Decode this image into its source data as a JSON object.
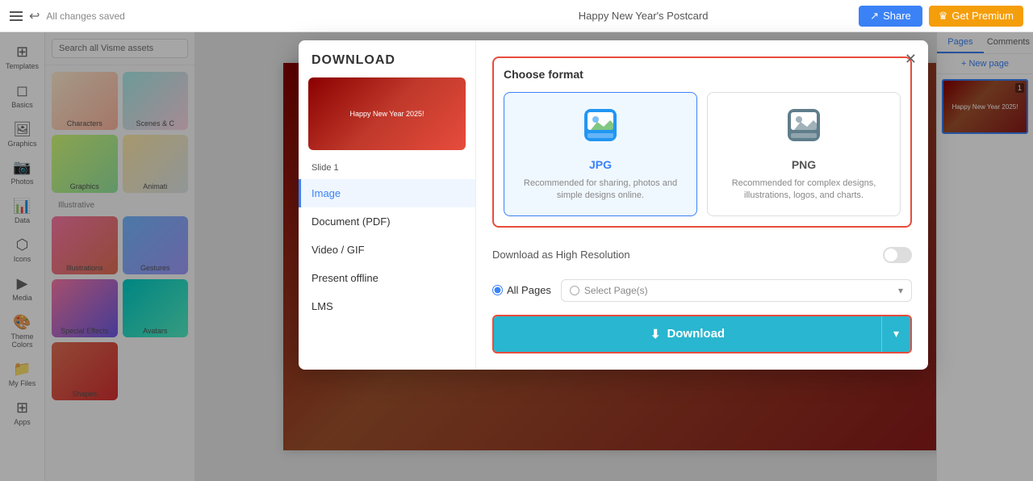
{
  "topbar": {
    "menu_icon": "☰",
    "undo_icon": "↩",
    "saved_text": "All changes saved",
    "title": "Happy New Year&#039;s Postcard",
    "share_label": "Share",
    "share_icon": "↗",
    "premium_label": "Get Premium",
    "premium_icon": "♛"
  },
  "sidebar": {
    "items": [
      {
        "icon": "⊞",
        "label": "Templates"
      },
      {
        "icon": "◻",
        "label": "Basics"
      },
      {
        "icon": "🖼",
        "label": "Graphics"
      },
      {
        "icon": "🖼",
        "label": "Photos"
      },
      {
        "icon": "📊",
        "label": "Data"
      },
      {
        "icon": "⊙",
        "label": "Icons"
      },
      {
        "icon": "▶",
        "label": "Media"
      },
      {
        "icon": "🎨",
        "label": "Theme Colors"
      },
      {
        "icon": "📁",
        "label": "My Files"
      },
      {
        "icon": "⊞",
        "label": "Apps"
      }
    ]
  },
  "asset_panel": {
    "search_placeholder": "Search all Visme assets",
    "section_label": "Illustrative",
    "tiles": [
      {
        "label": "Characters",
        "class": "tile-characters"
      },
      {
        "label": "Scenes & C",
        "class": "tile-scenes"
      },
      {
        "label": "Graphics",
        "class": "tile-graphics"
      },
      {
        "label": "Animati",
        "class": "tile-animations"
      },
      {
        "label": "Illustrations",
        "class": "tile-illustrations"
      },
      {
        "label": "Gestures",
        "class": "tile-gestures"
      },
      {
        "label": "Special Effects",
        "class": "tile-effects"
      },
      {
        "label": "Avatars",
        "class": "tile-avatars"
      },
      {
        "label": "Shapes",
        "class": "tile-shapes"
      }
    ]
  },
  "right_panel": {
    "tabs": [
      "Pages",
      "Comments"
    ],
    "new_page_label": "+ New page",
    "page_number": "1"
  },
  "modal": {
    "title": "DOWNLOAD",
    "close_icon": "✕",
    "slide_name": "Slide 1",
    "nav_items": [
      {
        "label": "Image",
        "active": true
      },
      {
        "label": "Document (PDF)",
        "active": false
      },
      {
        "label": "Video / GIF",
        "active": false
      },
      {
        "label": "Present offline",
        "active": false
      },
      {
        "label": "LMS",
        "active": false
      }
    ],
    "content": {
      "choose_format_label": "Choose format",
      "formats": [
        {
          "id": "jpg",
          "name": "JPG",
          "description": "Recommended for sharing, photos and simple designs online.",
          "selected": true
        },
        {
          "id": "png",
          "name": "PNG",
          "description": "Recommended for complex designs, illustrations, logos, and charts.",
          "selected": false
        }
      ],
      "hires_label": "Download as High Resolution",
      "hires_on": false,
      "all_pages_label": "All Pages",
      "select_pages_label": "Select Page(s)",
      "download_label": "Download",
      "download_icon": "⬇"
    }
  }
}
